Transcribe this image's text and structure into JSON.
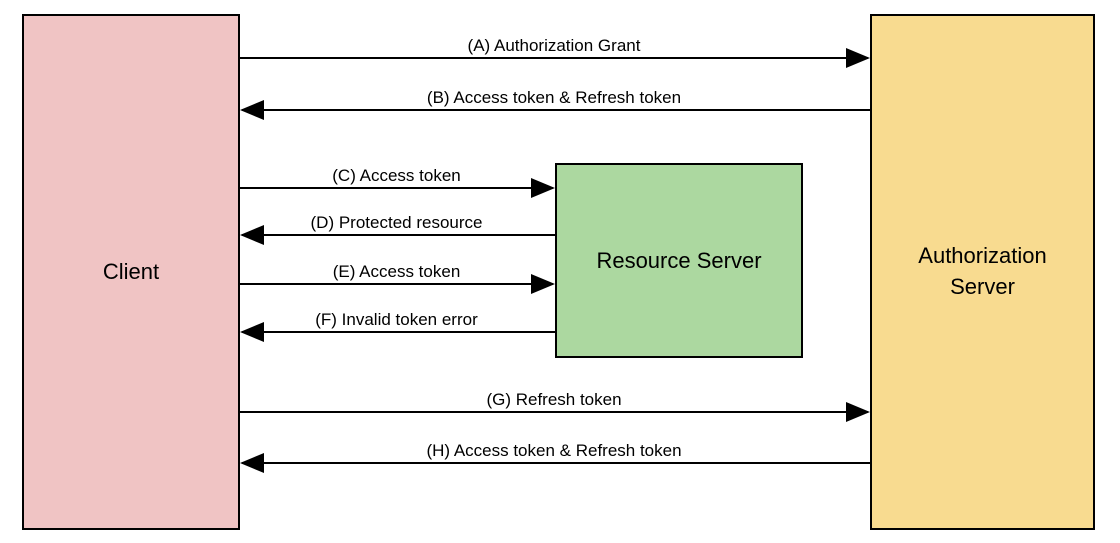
{
  "boxes": {
    "client": "Client",
    "resource": "Resource Server",
    "auth": "Authorization\nServer"
  },
  "arrows": {
    "a": "(A) Authorization Grant",
    "b": "(B) Access token & Refresh token",
    "c": "(C) Access token",
    "d": "(D) Protected resource",
    "e": "(E) Access token",
    "f": "(F) Invalid token error",
    "g": "(G) Refresh token",
    "h": "(H) Access token & Refresh token"
  }
}
